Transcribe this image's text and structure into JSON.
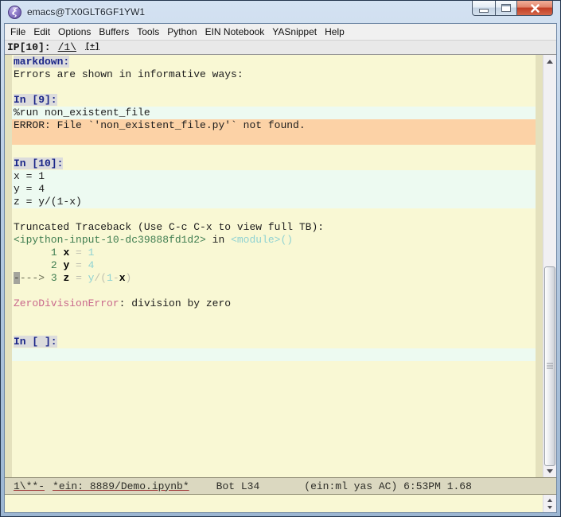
{
  "window": {
    "title": "emacs@TX0GLT6GF1YW1"
  },
  "icons": {
    "app": "emacs-logo",
    "app_glyph": "ξ",
    "minimize": "minimize-icon",
    "maximize": "maximize-icon",
    "close": "close-icon",
    "scroll_up": "arrow-up-icon",
    "scroll_down": "arrow-down-icon"
  },
  "menu": {
    "items": [
      "File",
      "Edit",
      "Options",
      "Buffers",
      "Tools",
      "Python",
      "EIN Notebook",
      "YASnippet",
      "Help"
    ]
  },
  "header_line": {
    "prompt": "IP[10]:",
    "tab_label": "/1\\",
    "new_tab_label": "[+]"
  },
  "buffer": {
    "lines": [
      {
        "bg": "plain",
        "segments": [
          {
            "t": "markdown:",
            "s": "label"
          }
        ]
      },
      {
        "bg": "plain",
        "segments": [
          {
            "t": "Errors are shown in informative ways:",
            "s": "plain"
          }
        ]
      },
      {
        "bg": "plain",
        "segments": []
      },
      {
        "bg": "plain",
        "segments": [
          {
            "t": "In [9]:",
            "s": "label"
          }
        ]
      },
      {
        "bg": "input",
        "segments": [
          {
            "t": "%run non_existent_file",
            "s": "plain"
          }
        ]
      },
      {
        "bg": "error",
        "segments": [
          {
            "t": "ERROR: File `'non_existent_file.py'` not found.",
            "s": "plain"
          }
        ]
      },
      {
        "bg": "error",
        "segments": []
      },
      {
        "bg": "plain",
        "segments": []
      },
      {
        "bg": "plain",
        "segments": [
          {
            "t": "In [10]:",
            "s": "label"
          }
        ]
      },
      {
        "bg": "input",
        "segments": [
          {
            "t": "x = 1",
            "s": "plain"
          }
        ]
      },
      {
        "bg": "input",
        "segments": [
          {
            "t": "y = 4",
            "s": "plain"
          }
        ]
      },
      {
        "bg": "input",
        "segments": [
          {
            "t": "z = y/(1-x)",
            "s": "plain"
          }
        ]
      },
      {
        "bg": "plain",
        "segments": []
      },
      {
        "bg": "plain",
        "segments": [
          {
            "t": "Truncated Traceback (Use C-c C-x to view full TB):",
            "s": "plain"
          }
        ]
      },
      {
        "bg": "plain",
        "segments": [
          {
            "t": "<ipython-input-10-dc39888fd1d2>",
            "s": "green"
          },
          {
            "t": " in ",
            "s": "plain"
          },
          {
            "t": "<module>()",
            "s": "cyan"
          }
        ]
      },
      {
        "bg": "plain",
        "segments": [
          {
            "t": "      ",
            "s": "plain"
          },
          {
            "t": "1",
            "s": "green"
          },
          {
            "t": " ",
            "s": "plain"
          },
          {
            "t": "x",
            "s": "bold"
          },
          {
            "t": " = ",
            "s": "op"
          },
          {
            "t": "1",
            "s": "cyan"
          }
        ]
      },
      {
        "bg": "plain",
        "segments": [
          {
            "t": "      ",
            "s": "plain"
          },
          {
            "t": "2",
            "s": "green"
          },
          {
            "t": " ",
            "s": "plain"
          },
          {
            "t": "y",
            "s": "bold"
          },
          {
            "t": " = ",
            "s": "op"
          },
          {
            "t": "4",
            "s": "cyan"
          }
        ]
      },
      {
        "bg": "plain",
        "segments": [
          {
            "t": "-",
            "s": "cursor"
          },
          {
            "t": "---> ",
            "s": "olive"
          },
          {
            "t": "3",
            "s": "green"
          },
          {
            "t": " ",
            "s": "plain"
          },
          {
            "t": "z",
            "s": "bold"
          },
          {
            "t": " = ",
            "s": "op"
          },
          {
            "t": "y",
            "s": "cyan"
          },
          {
            "t": "/(",
            "s": "op"
          },
          {
            "t": "1",
            "s": "cyan"
          },
          {
            "t": "-",
            "s": "op"
          },
          {
            "t": "x",
            "s": "bold"
          },
          {
            "t": ")",
            "s": "op"
          }
        ]
      },
      {
        "bg": "plain",
        "segments": []
      },
      {
        "bg": "plain",
        "segments": [
          {
            "t": "ZeroDivisionError",
            "s": "errname"
          },
          {
            "t": ": division by zero",
            "s": "plain"
          }
        ]
      },
      {
        "bg": "plain",
        "segments": []
      },
      {
        "bg": "plain",
        "segments": []
      },
      {
        "bg": "plain",
        "segments": [
          {
            "t": "In [ ]:",
            "s": "label"
          }
        ]
      },
      {
        "bg": "input",
        "segments": []
      }
    ]
  },
  "mode_line": {
    "flags": "1\\**-",
    "buffer_name": "*ein: 8889/Demo.ipynb*",
    "position": "Bot L34",
    "right": "(ein:ml yas AC) 6:53PM 1.68"
  },
  "echo": {
    "text": ""
  },
  "colors": {
    "buffer_bg": "#f9f8d4",
    "input_bg": "#edfaf1",
    "error_bg": "#fcd2a6",
    "label_bg": "#dcdcdc",
    "label_fg": "#1b2688",
    "traceback_green": "#3f7d50",
    "literal_cyan": "#8fd2d2",
    "error_name_pink": "#c9688c",
    "fringe": "#e4e1bd",
    "mode_line_bg": "#dbd8c0",
    "close_button_red": "#c23d24",
    "titlebar_glass": "#bccfe5"
  }
}
